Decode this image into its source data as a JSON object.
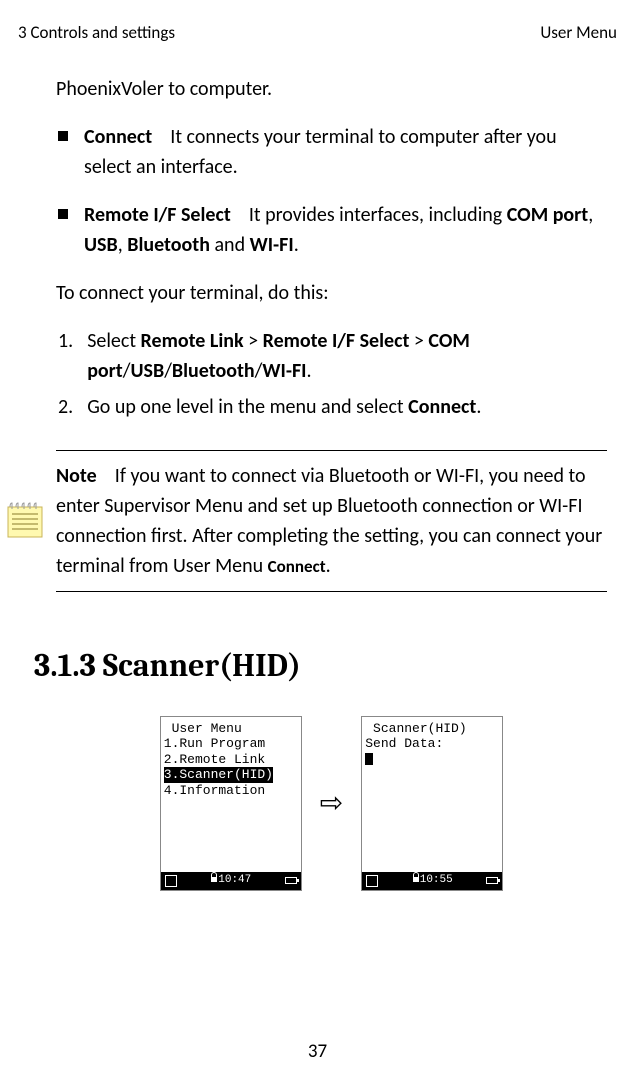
{
  "header": {
    "left": "3 Controls and settings",
    "right": "User Menu"
  },
  "intro": "PhoenixVoler to computer.",
  "bullets": [
    {
      "term": "Connect",
      "desc": "It connects your terminal to computer after you select an interface."
    },
    {
      "term": "Remote I/F Select",
      "desc_parts": {
        "p1": "It provides interfaces, including ",
        "b1": "COM port",
        "s1": ", ",
        "b2": "USB",
        "s2": ", ",
        "b3": "Bluetooth",
        "s3": " and ",
        "b4": "WI-FI",
        "s4": "."
      }
    }
  ],
  "instruct": "To connect your terminal, do this:",
  "steps": {
    "n1": "1.",
    "s1": {
      "p1": "Select ",
      "b1": "Remote Link",
      "s1": " > ",
      "b2": "Remote I/F Select",
      "s2": " > ",
      "b3": "COM port",
      "s3": "/",
      "b4": "USB",
      "s4": "/",
      "b5": "Bluetooth",
      "s5": "/",
      "b6": "WI-FI",
      "s6": "."
    },
    "n2": "2.",
    "s2": {
      "p1": "Go up one level in the menu and select ",
      "b1": "Connect",
      "s1": "."
    }
  },
  "note": {
    "label": "Note",
    "body": "If you want to connect via Bluetooth or WI-FI, you need to enter Supervisor Menu and set up Bluetooth connection or WI-FI connection first. After completing the setting, you can connect your terminal from User Menu ",
    "tail": "Connect",
    "dot": "."
  },
  "heading": "3.1.3  Scanner(HID)",
  "screen1": {
    "title": " User Menu",
    "l1": "1.Run Program",
    "l2": "2.Remote Link",
    "l3": "3.Scanner(HID)",
    "l4": "4.Information",
    "time": "10:47"
  },
  "screen2": {
    "title": " Scanner(HID)",
    "l1": "Send Data:",
    "time": "10:55"
  },
  "pagenum": "37"
}
